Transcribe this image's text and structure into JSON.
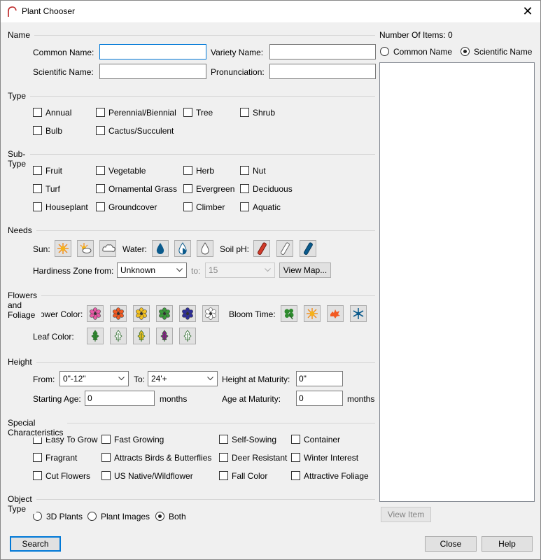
{
  "window": {
    "title": "Plant Chooser",
    "close_glyph": "✕",
    "accent": "#0078d7"
  },
  "name_section": {
    "heading": "Name",
    "common_name_label": "Common Name:",
    "common_name_value": "",
    "variety_name_label": "Variety Name:",
    "variety_name_value": "",
    "scientific_name_label": "Scientific Name:",
    "scientific_name_value": "",
    "pronunciation_label": "Pronunciation:",
    "pronunciation_value": ""
  },
  "type_section": {
    "heading": "Type",
    "options": [
      "Annual",
      "Perennial/Biennial",
      "Tree",
      "Shrub",
      "Bulb",
      "Cactus/Succulent"
    ]
  },
  "subtype_section": {
    "heading": "Sub-Type",
    "options": [
      "Fruit",
      "Vegetable",
      "Herb",
      "Nut",
      "Turf",
      "Ornamental Grass",
      "Evergreen",
      "Deciduous",
      "Houseplant",
      "Groundcover",
      "Climber",
      "Aquatic"
    ]
  },
  "needs_section": {
    "heading": "Needs",
    "sun_label": "Sun:",
    "water_label": "Water:",
    "soil_label": "Soil pH:",
    "sun_icons": [
      "full-sun-icon",
      "partial-sun-icon",
      "shade-cloud-icon"
    ],
    "water_icons": [
      "high-water-drop-icon",
      "medium-water-drop-icon",
      "low-water-drop-icon"
    ],
    "soil_icons": [
      "acidic-test-tube-icon",
      "neutral-test-tube-icon",
      "alkaline-test-tube-icon"
    ],
    "hardiness_label": "Hardiness Zone from:",
    "hardiness_from": "Unknown",
    "to_label": "to:",
    "hardiness_to": "15",
    "view_map_label": "View Map..."
  },
  "flowers_section": {
    "heading": "Flowers and Foliage",
    "flower_color_label": "Flower Color:",
    "flower_colors": [
      "#e85aa6",
      "#f25a22",
      "#f2c020",
      "#3a9a3a",
      "#2e2e99",
      "#ffffff"
    ],
    "bloom_time_label": "Bloom Time:",
    "bloom_icons": [
      "spring-flower-icon",
      "summer-sun-icon",
      "fall-leaf-icon",
      "winter-snowflake-icon"
    ],
    "leaf_color_label": "Leaf Color:",
    "leaf_colors": [
      "#2e8b2e",
      "#ffffff",
      "#f2c020",
      "#8b1a8b",
      "#ffffff"
    ]
  },
  "height_section": {
    "heading": "Height",
    "from_label": "From:",
    "from_value": "0\"-12\"",
    "to_label": "To:",
    "to_value": "24'+",
    "maturity_label": "Height at Maturity:",
    "maturity_value": "0\"",
    "starting_age_label": "Starting Age:",
    "starting_age_value": "0",
    "months_label": "months",
    "age_maturity_label": "Age at Maturity:",
    "age_maturity_value": "0",
    "months_label_2": "months"
  },
  "special_section": {
    "heading": "Special Characteristics",
    "options": [
      "Easy To Grow",
      "Fast Growing",
      "Self-Sowing",
      "Container",
      "Fragrant",
      "Attracts Birds & Butterflies",
      "Deer Resistant",
      "Winter Interest",
      "Cut Flowers",
      "US Native/Wildflower",
      "Fall Color",
      "Attractive Foliage"
    ]
  },
  "object_type_section": {
    "heading": "Object Type",
    "options": [
      "3D Plants",
      "Plant Images",
      "Both"
    ],
    "selected": "Both"
  },
  "results": {
    "count_label": "Number Of Items: 0",
    "sort_common": "Common Name",
    "sort_scientific": "Scientific Name",
    "sort_selected": "Scientific Name",
    "view_item_label": "View Item"
  },
  "footer": {
    "search_label": "Search",
    "close_label": "Close",
    "help_label": "Help"
  }
}
